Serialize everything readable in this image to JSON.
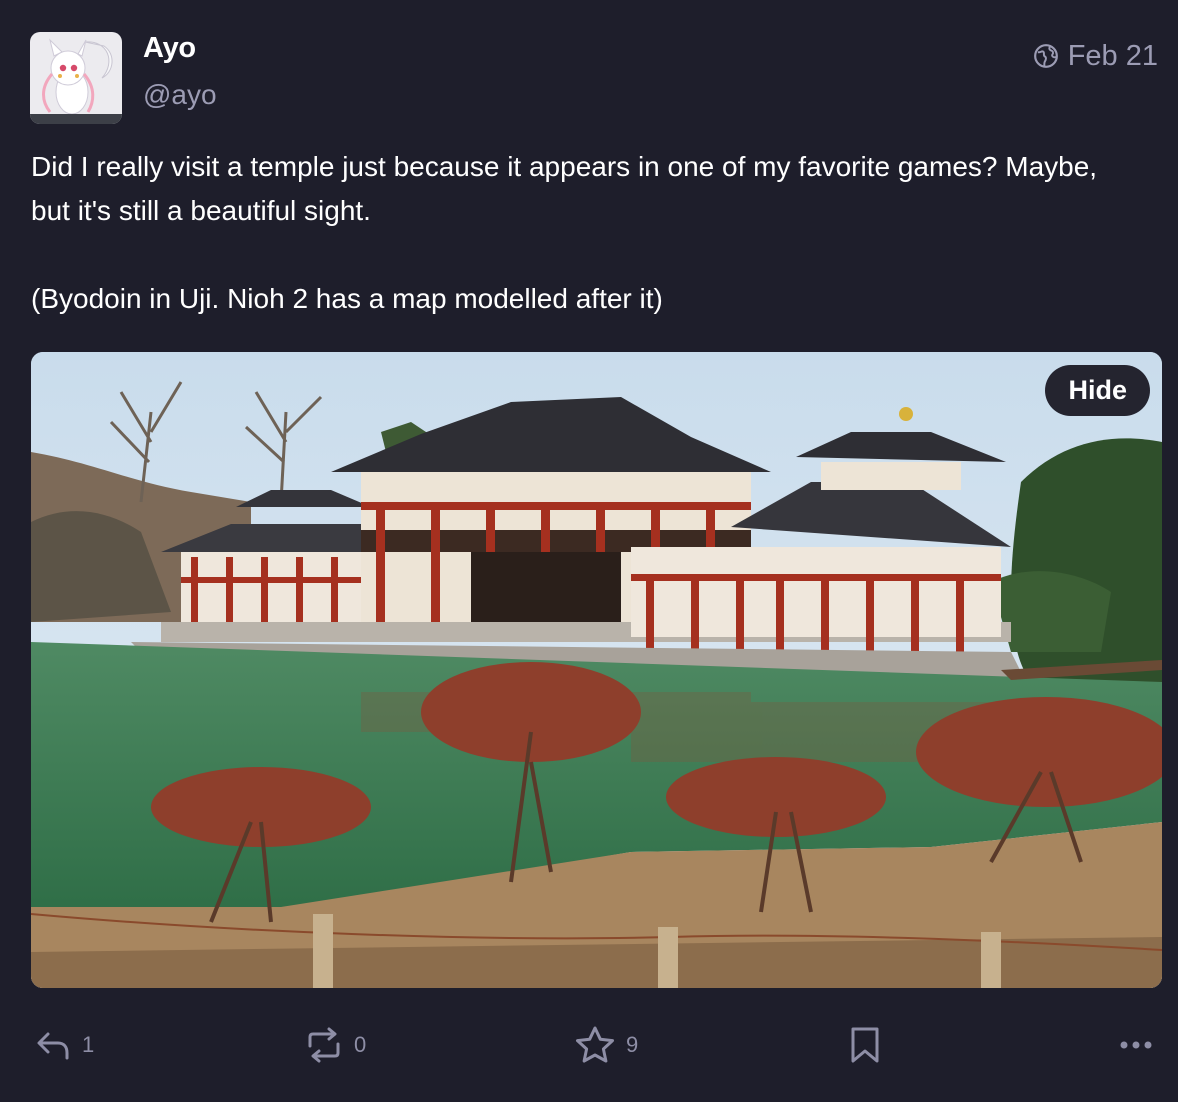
{
  "author": {
    "display_name": "Ayo",
    "handle": "@ayo",
    "avatar": "white-cat-creature-avatar"
  },
  "meta": {
    "visibility_icon": "globe-icon",
    "date": "Feb 21"
  },
  "status": {
    "paragraphs": [
      "Did I really visit a temple just because it appears in one of my favorite games? Maybe, but it's still a beautiful sight.",
      "(Byodoin in Uji. Nioh 2 has a map modelled after it)"
    ]
  },
  "media": {
    "hide_label": "Hide"
  },
  "actions": {
    "reply": {
      "icon": "reply-icon",
      "count": "1"
    },
    "boost": {
      "icon": "boost-icon",
      "count": "0"
    },
    "favourite": {
      "icon": "star-icon",
      "count": "9"
    },
    "bookmark": {
      "icon": "bookmark-icon"
    },
    "more": {
      "icon": "more-icon"
    }
  },
  "colors": {
    "background": "#1e1e2b",
    "muted_text": "#9c9cb4",
    "icon": "#8e8ea6"
  }
}
